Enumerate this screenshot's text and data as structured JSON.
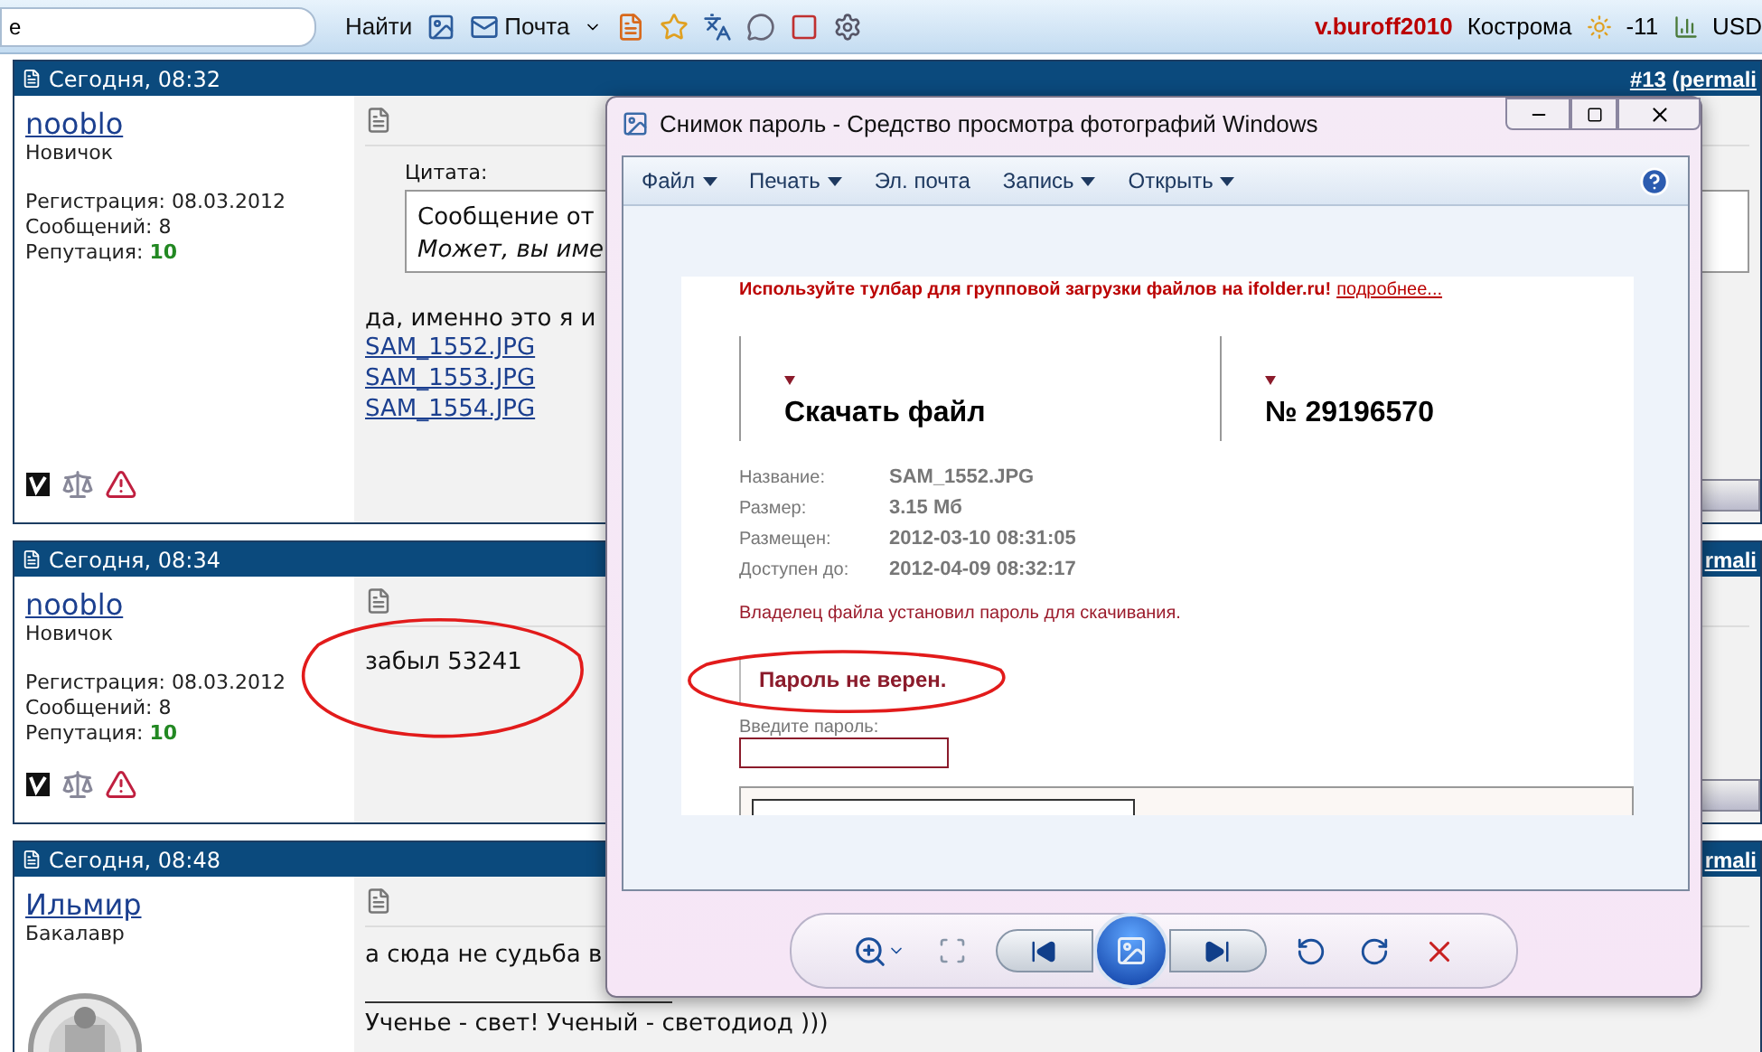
{
  "toolbar": {
    "search_value": "e",
    "find_button": "Найти",
    "mail_button": "Почта",
    "user": "v.buroff2010",
    "city": "Кострома",
    "temperature": "-11",
    "currency": "USD"
  },
  "posts": [
    {
      "kind": "quote",
      "date": "Сегодня, 08:32",
      "number": "#13",
      "open_paren": " (",
      "link": "permali",
      "user": "nooblo",
      "rank": "Новичок",
      "registration": "Регистрация: 08.03.2012",
      "messages": "Сообщений: 8",
      "reputation_label": "Репутация: ",
      "reputation": "10",
      "quote_label": "Цитата:",
      "quote_from": "Сообщение от ",
      "quote_text": "Может, вы име",
      "text": "да, именно это я и",
      "files": [
        "SAM_1552.JPG",
        "SAM_1553.JPG",
        "SAM_1554.JPG"
      ]
    },
    {
      "kind": "plain",
      "date": "Сегодня, 08:34",
      "link": "rmali",
      "user": "nooblo",
      "rank": "Новичок",
      "registration": "Регистрация: 08.03.2012",
      "messages": "Сообщений: 8",
      "reputation_label": "Репутация: ",
      "reputation": "10",
      "text": "забыл 53241",
      "circled": true
    },
    {
      "kind": "signature",
      "date": "Сегодня, 08:48",
      "link": "rmali",
      "user": "Ильмир",
      "rank": "Бакалавр",
      "text": "а сюда не судьба в",
      "signature": "Ученье - свет! Ученый - светодиод )))"
    }
  ],
  "viewer": {
    "title": "Снимок пароль - Средство просмотра фотографий Windows",
    "menu": [
      {
        "label": "Файл",
        "dropdown": true
      },
      {
        "label": "Печать",
        "dropdown": true
      },
      {
        "label": "Эл. почта",
        "dropdown": false
      },
      {
        "label": "Запись",
        "dropdown": true
      },
      {
        "label": "Открыть",
        "dropdown": true
      }
    ],
    "image": {
      "banner": "Используйте тулбар для групповой загрузки файлов на ifolder.ru!",
      "banner_link": "подробнее...",
      "download": "Скачать файл",
      "number": "№ 29196570",
      "fields": [
        {
          "label": "Название:",
          "value": "SAM_1552.JPG"
        },
        {
          "label": "Размер:",
          "value": "3.15 Мб"
        },
        {
          "label": "Размещен:",
          "value": "2012-03-10 08:31:05"
        },
        {
          "label": "Доступен до:",
          "value": "2012-04-09 08:32:17"
        }
      ],
      "owner_note": "Владелец файла установил пароль для скачивания.",
      "error": "Пароль не верен.",
      "error_circled": true,
      "password_label": "Введите пароль:"
    }
  }
}
